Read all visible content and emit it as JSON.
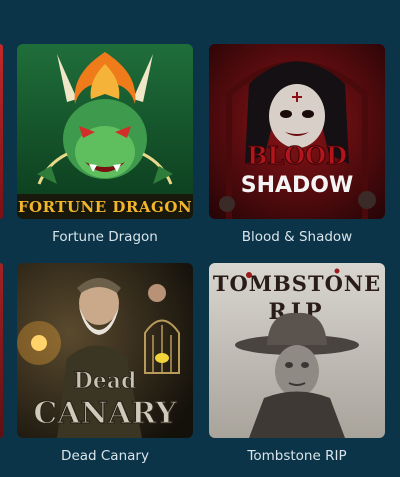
{
  "games": [
    {
      "title": "Fortune Dragon",
      "art_text": "FORTUNE DRAGON",
      "art_icon": "dragon-art"
    },
    {
      "title": "Blood & Shadow",
      "art_text_top": "BLOOD",
      "art_text_bottom": "SHADOW",
      "art_icon": "vampire-art"
    },
    {
      "title": "Dead Canary",
      "art_text_top": "Dead",
      "art_text_bottom": "CANARY",
      "art_icon": "miner-art"
    },
    {
      "title": "Tombstone RIP",
      "art_text_top": "TOMBSTONE",
      "art_text_bottom": "RIP",
      "art_icon": "cowboy-art"
    }
  ],
  "colors": {
    "background": "#0c3448",
    "label_text": "#d8e4ea"
  }
}
